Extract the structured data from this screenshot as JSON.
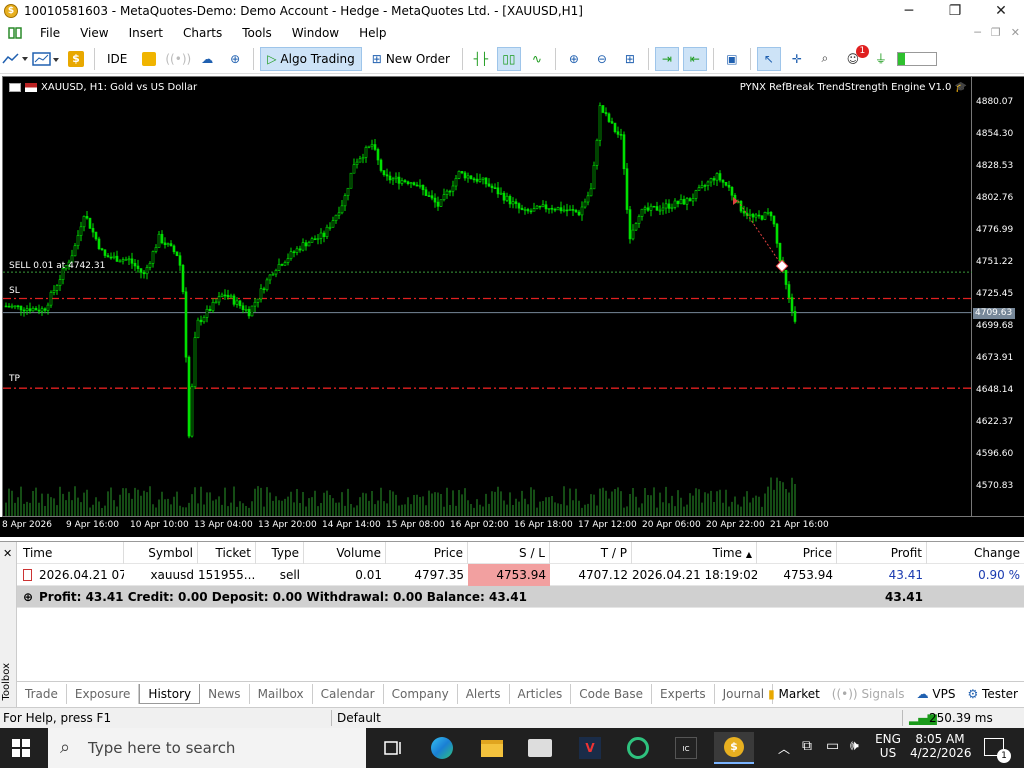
{
  "window": {
    "title": "10010581603 - MetaQuotes-Demo: Demo Account - Hedge - MetaQuotes Ltd. - [XAUUSD,H1]",
    "minimize": "─",
    "maximize": "❐",
    "close": "✕"
  },
  "menu": [
    "File",
    "View",
    "Insert",
    "Charts",
    "Tools",
    "Window",
    "Help"
  ],
  "toolbar": {
    "ide": "IDE",
    "algo_trading": "Algo Trading",
    "new_order": "New Order",
    "alerts_badge": "1"
  },
  "chart": {
    "symbol_label": "XAUUSD, H1:  Gold vs US Dollar",
    "ea_name": "PYNX RefBreak TrendStrength Engine V1.0",
    "sell_label": "SELL 0.01 at 4742.31",
    "sl_label": "SL",
    "tp_label": "TP",
    "current_price": "4709.63",
    "price_ticks": [
      "4880.07",
      "4854.30",
      "4828.53",
      "4802.76",
      "4776.99",
      "4751.22",
      "4725.45",
      "4699.68",
      "4673.91",
      "4648.14",
      "4622.37",
      "4596.60",
      "4570.83"
    ],
    "time_ticks": [
      "8 Apr 2026",
      "9 Apr 16:00",
      "10 Apr 10:00",
      "13 Apr 04:00",
      "13 Apr 20:00",
      "14 Apr 14:00",
      "15 Apr 08:00",
      "16 Apr 02:00",
      "16 Apr 18:00",
      "17 Apr 12:00",
      "20 Apr 06:00",
      "20 Apr 22:00",
      "21 Apr 16:00"
    ],
    "colors": {
      "bull": "#00e000",
      "bear": "#00e000",
      "background": "#000000",
      "sl_tp_line": "#e02020",
      "entry_line": "#3a9a3a"
    }
  },
  "history": {
    "columns": [
      "Time",
      "Symbol",
      "Ticket",
      "Type",
      "Volume",
      "Price",
      "S / L",
      "T / P",
      "Time",
      "Price",
      "Profit",
      "Change"
    ],
    "sort_indicator": "▲",
    "row": {
      "time_open": "2026.04.21 07:...",
      "symbol": "xauusd",
      "ticket": "151955...",
      "type": "sell",
      "volume": "0.01",
      "price_open": "4797.35",
      "sl": "4753.94",
      "tp": "4707.12",
      "time_close": "2026.04.21 18:19:02",
      "price_close": "4753.94",
      "profit": "43.41",
      "change": "0.90 %"
    },
    "summary": "Profit: 43.41  Credit: 0.00  Deposit: 0.00  Withdrawal: 0.00  Balance: 43.41",
    "summary_total": "43.41"
  },
  "toolbox_label": "Toolbox",
  "tabs": [
    "Trade",
    "Exposure",
    "History",
    "News",
    "Mailbox",
    "Calendar",
    "Company",
    "Alerts",
    "Articles",
    "Code Base",
    "Experts",
    "Journal"
  ],
  "tabs_right": [
    "Market",
    "Signals",
    "VPS",
    "Tester"
  ],
  "status": {
    "help": "For Help, press F1",
    "profile": "Default",
    "ping": "250.39 ms"
  },
  "taskbar": {
    "search_placeholder": "Type here to search",
    "lang": "ENG",
    "region": "US",
    "time": "8:05 AM",
    "date": "4/22/2026",
    "notif_count": "1"
  }
}
